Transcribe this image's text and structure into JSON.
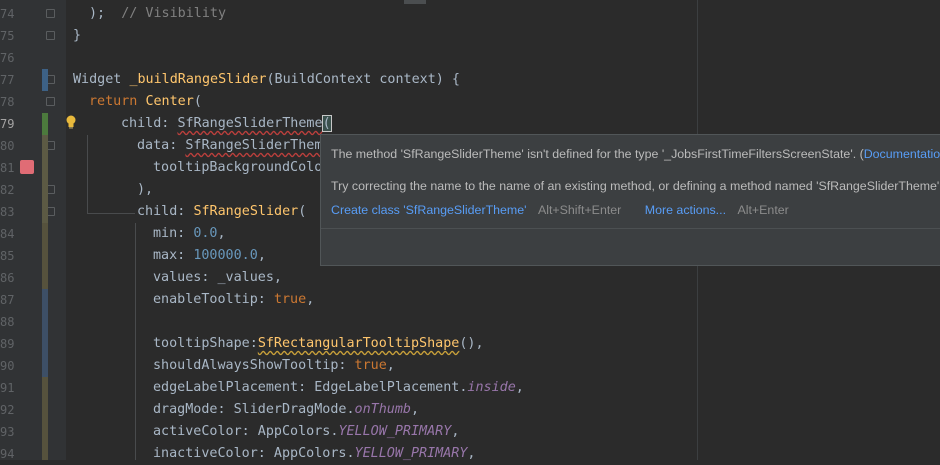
{
  "gutter": {
    "line_numbers": [
      "74",
      "75",
      "76",
      "77",
      "78",
      "79",
      "80",
      "81",
      "82",
      "83",
      "84",
      "85",
      "86",
      "87",
      "88",
      "89",
      "90",
      "91",
      "92",
      "93",
      "94"
    ]
  },
  "code": {
    "l74_a": ");",
    "l74_b": "// Visibility",
    "l75": "}",
    "l77_a": "Widget ",
    "l77_b": "_buildRangeSlider",
    "l77_c": "(BuildContext context) {",
    "l78_a": "return ",
    "l78_b": "Center",
    "l78_c": "(",
    "l79_a": "child: ",
    "l79_b": "SfRangeSliderTheme",
    "l79_c": "(",
    "l80_a": "data: ",
    "l80_b": "SfRangeSliderThem",
    "l81": "tooltipBackgroundColo",
    "l82": "),",
    "l83_a": "child: ",
    "l83_b": "SfRangeSlider",
    "l83_c": "(",
    "l84_a": "min: ",
    "l84_b": "0.0",
    "l84_c": ",",
    "l85_a": "max: ",
    "l85_b": "100000.0",
    "l85_c": ",",
    "l86": "values: _values,",
    "l87_a": "enableTooltip: ",
    "l87_b": "true",
    "l87_c": ",",
    "l89_a": "tooltipShape:",
    "l89_b": "SfRectangularTooltipShape",
    "l89_c": "(),",
    "l90_a": "shouldAlwaysShowTooltip: ",
    "l90_b": "true",
    "l90_c": ",",
    "l91_a": "edgeLabelPlacement: EdgeLabelPlacement.",
    "l91_b": "inside",
    "l91_c": ",",
    "l92_a": "dragMode: SliderDragMode.",
    "l92_b": "onThumb",
    "l92_c": ",",
    "l93_a": "activeColor: AppColors.",
    "l93_b": "YELLOW_PRIMARY",
    "l93_c": ",",
    "l94_a": "inactiveColor: AppColors.",
    "l94_b": "YELLOW_PRIMARY",
    "l94_c": ","
  },
  "popup": {
    "message": "The method 'SfRangeSliderTheme' isn't defined for the type '_JobsFirstTimeFiltersScreenState'. (",
    "doc_link": "Documentation",
    "message_end": ")",
    "suggestion": "Try correcting the name to the name of an existing method, or defining a method named 'SfRangeSliderTheme'.",
    "action_create": "Create class 'SfRangeSliderTheme'",
    "action_create_shortcut": "Alt+Shift+Enter",
    "action_more": "More actions...",
    "action_more_shortcut": "Alt+Enter"
  },
  "colors": {
    "background": "#2b2b2b",
    "gutter": "#313335",
    "keyword": "#cc7832",
    "function": "#ffc66d",
    "number": "#6897bb",
    "property": "#9876aa",
    "link": "#589df6"
  }
}
